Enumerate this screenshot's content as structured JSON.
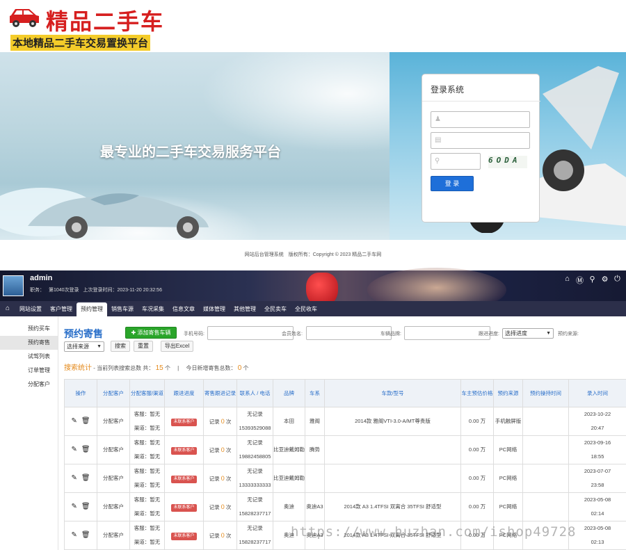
{
  "site": {
    "brand": "精品二手车",
    "slogan": "本地精品二手车交易置换平台",
    "banner_title": "最专业的二手车交易服务平台"
  },
  "login": {
    "title": "登录系统",
    "captcha_code": "6ODA",
    "button": "登 录",
    "user_icon": "user-icon",
    "lock_icon": "lock-icon",
    "key_icon": "key-icon"
  },
  "footer": "网站后台管理系统　版权所有：Copyright © 2023 精品二手车网",
  "admin": {
    "username": "admin",
    "info_role": "职务：",
    "info_logins": "第1040次登录",
    "info_last": "上次登录时间：2023-11-20 20:32:56"
  },
  "nav": [
    "网站设置",
    "客户管理",
    "预约管理",
    "销售车源",
    "车况采集",
    "信息文章",
    "媒体管理",
    "其他管理",
    "全民卖车",
    "全民收车"
  ],
  "nav_active": 2,
  "sidebar": [
    "预约买车",
    "预约寄售",
    "试驾列表",
    "订单管理",
    "分配客户"
  ],
  "sidebar_active": 1,
  "page": {
    "title": "预约寄售",
    "add_button": "添加寄售车辆",
    "label_phone": "手机号码:",
    "label_member": "会员姓名:",
    "label_brand": "车辆品牌:",
    "label_progress": "跟进进度:",
    "progress_select": "选择进度",
    "label_source": "预约来源:",
    "source_select": "选择来源",
    "btn_search": "搜索",
    "btn_reset": "重置",
    "btn_export": "导出Excel",
    "stat_label": "搜索统计",
    "stat_total_pre": "- 当前列表搜索总数 共：",
    "stat_total": "15",
    "stat_unit": "个",
    "stat_sep": "|",
    "stat_today_pre": "今日新增寄售总数：",
    "stat_today": "0",
    "stat_today_unit": "个"
  },
  "table": {
    "headers": [
      "操作",
      "分配客户",
      "分配客服/渠道",
      "跟进进度",
      "寄售跟进记录",
      "联系人 / 电话",
      "品牌",
      "车系",
      "车款/型号",
      "车主预估价格",
      "预约来源",
      "预约操持时间",
      "录入时间"
    ],
    "rows": [
      {
        "assign": "分配客户",
        "kf": "客服：暂无",
        "qd": "渠道：暂无",
        "status": "未联系客户",
        "rec": "记录",
        "cnt": "0",
        "unit": "次",
        "contact": "无记录",
        "phone": "15393529088",
        "brand": "本田",
        "series": "雅阁",
        "model": "2014款 雅阁VTI-3.0-A/MT尊贵版",
        "price": "0.00 万",
        "source": "手机触屏版",
        "optime": "",
        "date": "2023-10-22",
        "time": "20:47"
      },
      {
        "assign": "分配客户",
        "kf": "客服：暂无",
        "qd": "渠道：暂无",
        "status": "未联系客户",
        "rec": "记录",
        "cnt": "0",
        "unit": "次",
        "contact": "无记录",
        "phone": "19882458805",
        "brand": "比亚迪戴姆勒",
        "series": "腾势",
        "model": "",
        "price": "0.00 万",
        "source": "PC网络",
        "optime": "",
        "date": "2023-09-16",
        "time": "18:55"
      },
      {
        "assign": "分配客户",
        "kf": "客服：暂无",
        "qd": "渠道：暂无",
        "status": "未联系客户",
        "rec": "记录",
        "cnt": "0",
        "unit": "次",
        "contact": "无记录",
        "phone": "13333333333",
        "brand": "比亚迪戴姆勒",
        "series": "",
        "model": "",
        "price": "0.00 万",
        "source": "PC网络",
        "optime": "",
        "date": "2023-07-07",
        "time": "23:58"
      },
      {
        "assign": "分配客户",
        "kf": "客服：暂无",
        "qd": "渠道：暂无",
        "status": "未联系客户",
        "rec": "记录",
        "cnt": "0",
        "unit": "次",
        "contact": "无记录",
        "phone": "15828237717",
        "brand": "奥迪",
        "series": "奥迪A3",
        "model": "2014款 A3 1.4TFSI 双离合 35TFSI 舒适型",
        "price": "0.00 万",
        "source": "PC网络",
        "optime": "",
        "date": "2023-05-08",
        "time": "02:14"
      },
      {
        "assign": "分配客户",
        "kf": "客服：暂无",
        "qd": "渠道：暂无",
        "status": "未联系客户",
        "rec": "记录",
        "cnt": "0",
        "unit": "次",
        "contact": "无记录",
        "phone": "15828237717",
        "brand": "奥迪",
        "series": "奥迪A3",
        "model": "2014款 A3 1.4TFSI 双离合 35TFSI 舒适型",
        "price": "0.00 万",
        "source": "PC网络",
        "optime": "",
        "date": "2023-05-08",
        "time": "02:13"
      }
    ]
  },
  "watermark": "https://www.huzhan.com/ishop49728",
  "colors": {
    "brand_red": "#d61f1f",
    "accent_blue": "#2a6fc9",
    "add_green": "#2aa52a",
    "badge_red": "#d9534f",
    "count_orange": "#e48a1c"
  }
}
